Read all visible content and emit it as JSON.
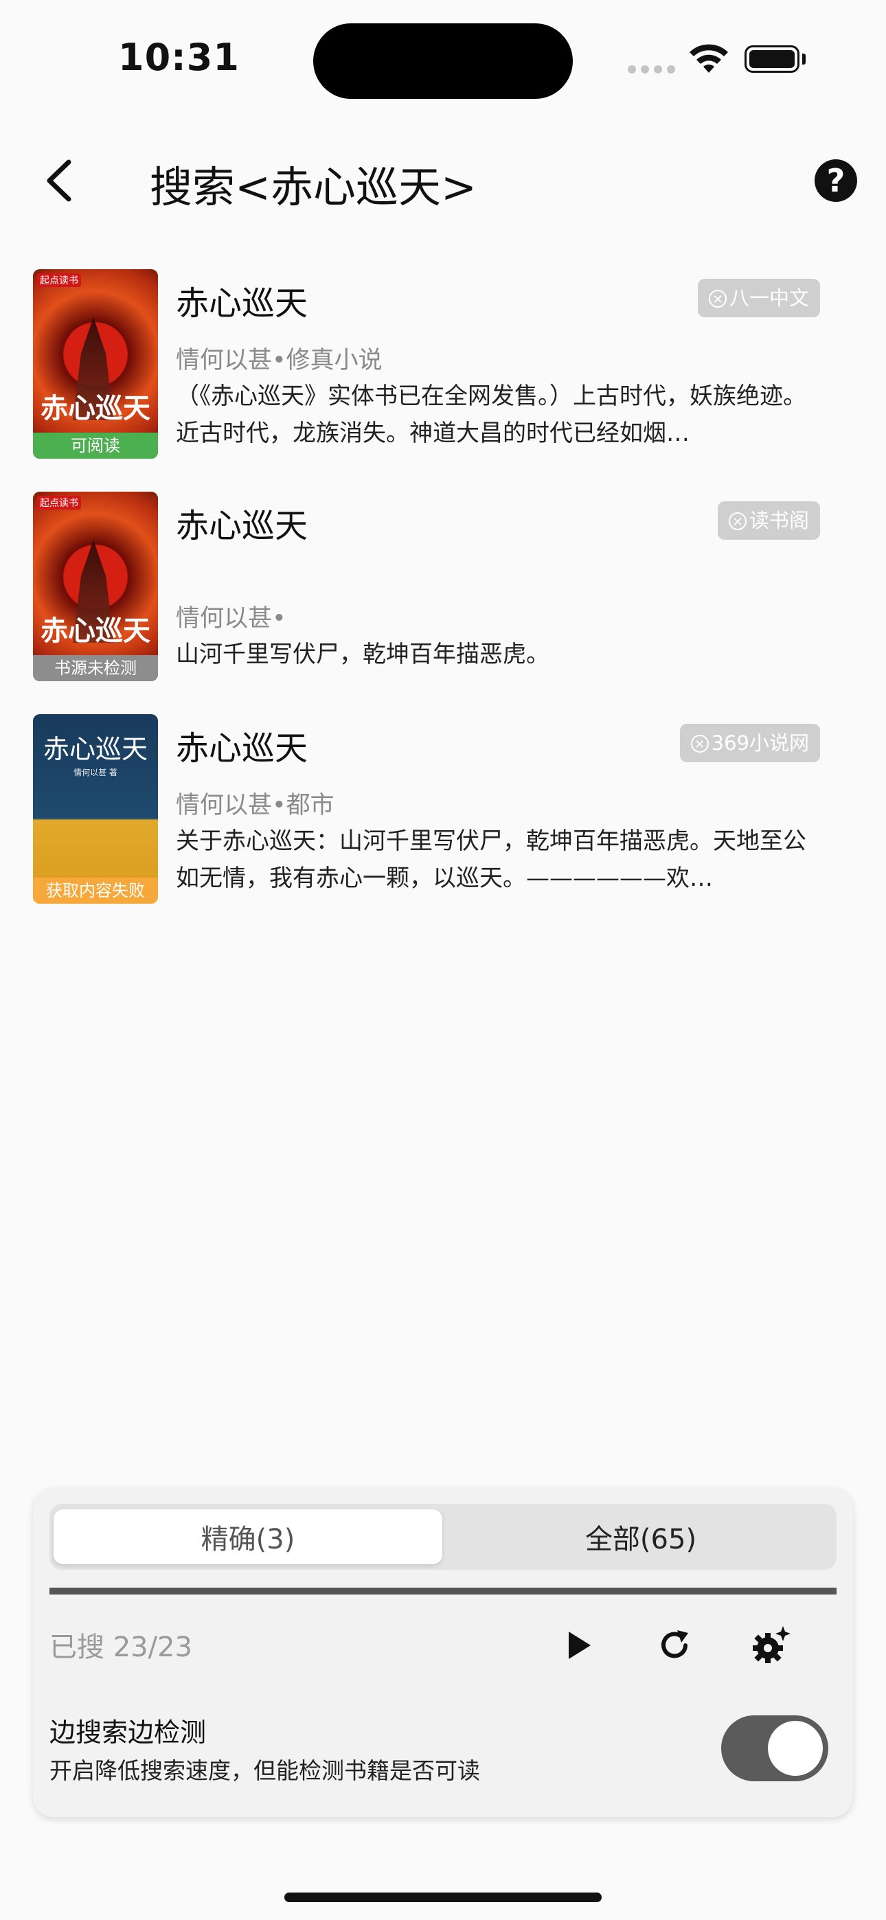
{
  "status_bar": {
    "time": "10:31"
  },
  "header": {
    "title": "搜索<赤心巡天>"
  },
  "results": [
    {
      "title": "赤心巡天",
      "source": "八一中文",
      "meta": "情何以甚•修真小说",
      "desc": "（《赤心巡天》实体书已在全网发售。）上古时代，妖族绝迹。近古时代，龙族消失。神道大昌的时代已经如烟…",
      "cover_status": "可阅读",
      "cover_title": "赤心巡天",
      "cover_brand": "起点读书"
    },
    {
      "title": "赤心巡天",
      "source": "读书阁",
      "meta": "情何以甚•",
      "desc": "山河千里写伏尸，乾坤百年描恶虎。",
      "cover_status": "书源未检测",
      "cover_title": "赤心巡天",
      "cover_brand": "起点读书"
    },
    {
      "title": "赤心巡天",
      "source": "369小说网",
      "meta": "情何以甚•都市",
      "desc": "关于赤心巡天：山河千里写伏尸，乾坤百年描恶虎。天地至公如无情，我有赤心一颗，以巡天。——————欢…",
      "cover_status": "获取内容失败",
      "cover_title": "赤心巡天",
      "cover_sub": "情何以甚 著"
    }
  ],
  "panel": {
    "tab_exact": "精确(3)",
    "tab_all": "全部(65)",
    "progress": 1.0,
    "searched": "已搜 23/23",
    "toggle_title": "边搜索边检测",
    "toggle_subtitle": "开启降低搜索速度，但能检测书籍是否可读",
    "toggle_on": true
  },
  "colors": {
    "status_readable": "#4caf50",
    "status_unchecked": "#8d8d8d",
    "status_failed": "#f7a83a",
    "badge": "#cfcfcf"
  },
  "icons": [
    "back-arrow-icon",
    "help-icon",
    "play-icon",
    "refresh-icon",
    "settings-sparkle-icon",
    "wifi-icon",
    "battery-icon"
  ]
}
